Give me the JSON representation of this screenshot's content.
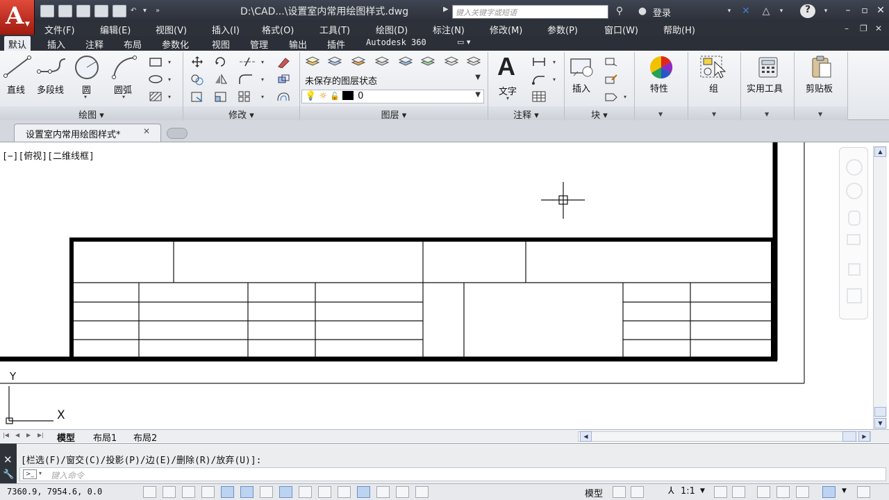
{
  "window": {
    "title": "D:\\CAD...\\设置室内常用绘图样式.dwg",
    "search_placeholder": "键入关键字或短语",
    "login": "登录"
  },
  "menu": [
    "文件(F)",
    "编辑(E)",
    "视图(V)",
    "插入(I)",
    "格式(O)",
    "工具(T)",
    "绘图(D)",
    "标注(N)",
    "修改(M)",
    "参数(P)",
    "窗口(W)",
    "帮助(H)"
  ],
  "ribbon_tabs": [
    "默认",
    "插入",
    "注释",
    "布局",
    "参数化",
    "视图",
    "管理",
    "输出",
    "插件",
    "Autodesk 360"
  ],
  "ribbon": {
    "draw": {
      "title": "绘图",
      "line": "直线",
      "polyline": "多段线",
      "circle": "圆",
      "arc": "圆弧"
    },
    "modify": {
      "title": "修改"
    },
    "layers": {
      "title": "图层",
      "layer_state": "未保存的图层状态",
      "current_layer": "0"
    },
    "annotation": {
      "title": "注释",
      "text": "文字"
    },
    "block": {
      "title": "块",
      "insert": "插入"
    },
    "properties": {
      "label": "特性"
    },
    "groups": {
      "label": "组"
    },
    "utilities": {
      "label": "实用工具"
    },
    "clipboard": {
      "label": "剪贴板"
    }
  },
  "document_tab": "设置室内常用绘图样式*",
  "viewport_label": "[−][俯视][二维线框]",
  "layout_tabs": [
    "模型",
    "布局1",
    "布局2"
  ],
  "command": {
    "history": "[栏选(F)/窗交(C)/投影(P)/边(E)/删除(R)/放弃(U)]:",
    "placeholder": "键入命令",
    "prompt_icon": ">_"
  },
  "status": {
    "coords": "7360.9, 7954.6, 0.0",
    "model": "模型",
    "scale": "1:1"
  },
  "ucs": {
    "x_label": "X",
    "y_label": "Y"
  }
}
